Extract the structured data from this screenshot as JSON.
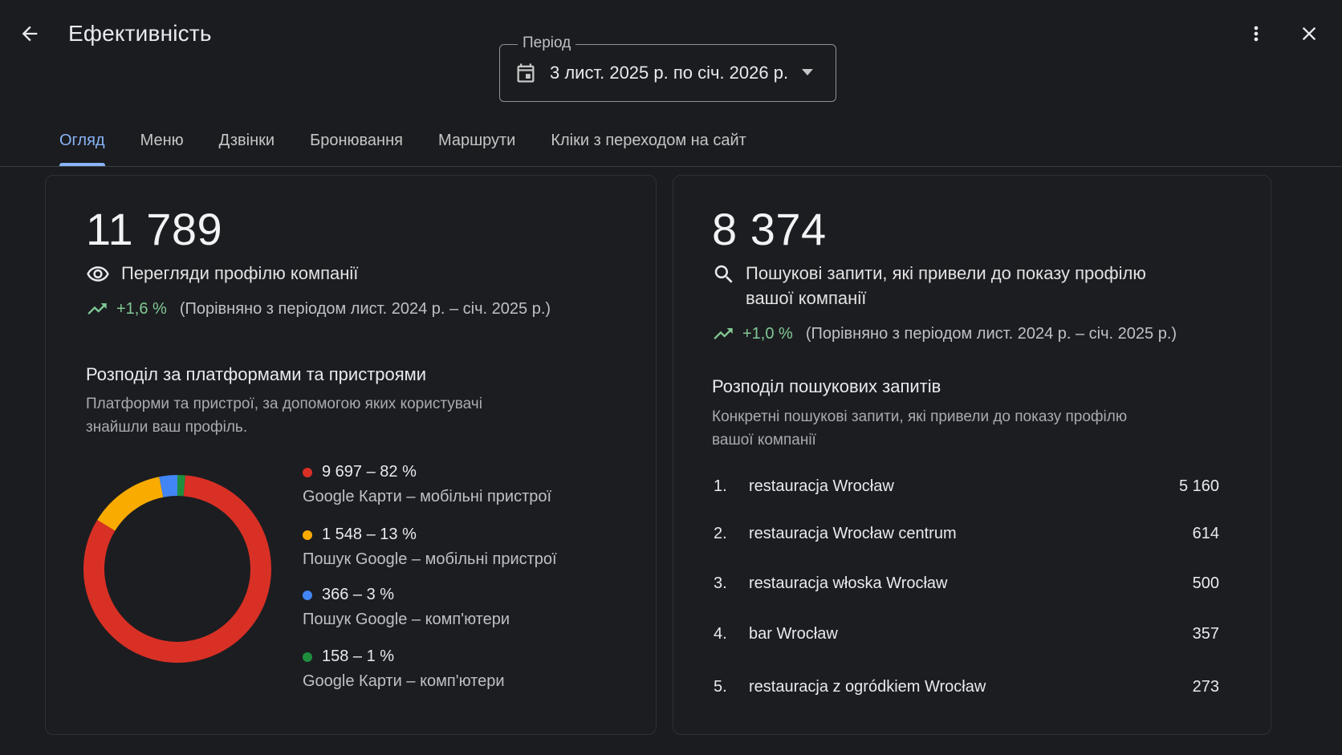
{
  "header": {
    "title": "Ефективність",
    "back_icon": "arrow-back-icon",
    "more_icon": "more-vert-icon",
    "close_icon": "close-icon"
  },
  "period": {
    "label": "Період",
    "value": "3 лист. 2025 р. по січ. 2026 р.",
    "icon": "calendar-icon"
  },
  "tabs": [
    {
      "label": "Огляд",
      "active": true
    },
    {
      "label": "Меню"
    },
    {
      "label": "Дзвінки"
    },
    {
      "label": "Бронювання"
    },
    {
      "label": "Маршрути"
    },
    {
      "label": "Кліки з переходом на сайт"
    }
  ],
  "profile_views": {
    "total": "11 789",
    "label": "Перегляди профілю компанії",
    "icon": "eye-icon",
    "trend_pct": "+1,6 %",
    "trend_note": "(Порівняно з періодом лист. 2024 р. – січ. 2025 р.)",
    "breakdown_title": "Розподіл за платформами та пристроями",
    "breakdown_desc_line1": "Платформи та пристрої, за допомогою яких користувачі",
    "breakdown_desc_line2": "знайшли ваш профіль."
  },
  "search_queries": {
    "total": "8 374",
    "label_line1": "Пошукові запити, які привели до показу профілю",
    "label_line2": "вашої компанії",
    "icon": "search-icon",
    "trend_pct": "+1,0 %",
    "trend_note": "(Порівняно з періодом лист. 2024 р. – січ. 2025 р.)",
    "breakdown_title": "Розподіл пошукових запитів",
    "breakdown_desc_line1": "Конкретні пошукові запити, які привели до показу профілю",
    "breakdown_desc_line2": "вашої компанії",
    "items": [
      {
        "rank": "1.",
        "query": "restauracja Wrocław",
        "count": "5 160"
      },
      {
        "rank": "2.",
        "query": "restauracja Wrocław centrum",
        "count": "614"
      },
      {
        "rank": "3.",
        "query": "restauracja włoska Wrocław",
        "count": "500"
      },
      {
        "rank": "4.",
        "query": "bar Wrocław",
        "count": "357"
      },
      {
        "rank": "5.",
        "query": "restauracja z ogródkiem Wrocław",
        "count": "273"
      }
    ]
  },
  "chart_data": {
    "type": "pie",
    "series": [
      {
        "name": "Google Карти – мобільні пристрої",
        "value": 9697,
        "percent": 82,
        "label": "9 697 – 82 %",
        "color": "#d93025"
      },
      {
        "name": "Пошук Google – мобільні пристрої",
        "value": 1548,
        "percent": 13,
        "label": "1 548 – 13 %",
        "color": "#f9ab00"
      },
      {
        "name": "Пошук Google – комп'ютери",
        "value": 366,
        "percent": 3,
        "label": "366 – 3 %",
        "color": "#4285f4"
      },
      {
        "name": "Google Карти – комп'ютери",
        "value": 158,
        "percent": 1,
        "label": "158 – 1 %",
        "color": "#1e8e3e"
      }
    ]
  }
}
